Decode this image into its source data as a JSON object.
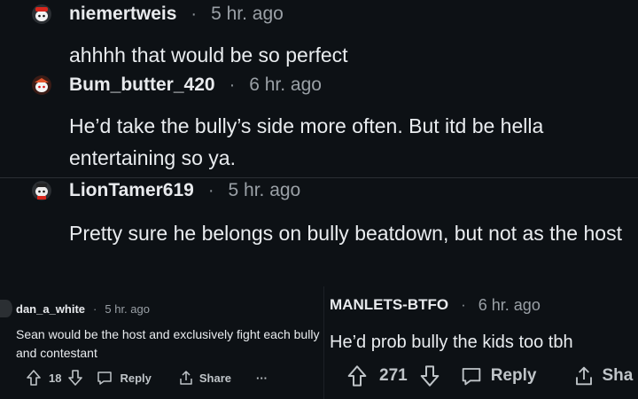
{
  "colors": {
    "background": "#0d1115",
    "text": "#e9ecef",
    "meta": "#9aa0a6",
    "divider": "#2a2f34"
  },
  "comments": [
    {
      "username": "niemertweis",
      "time": "5 hr. ago",
      "text": "ahhhh that would be so perfect",
      "avatar_icon": "snoo-avatar-icon"
    },
    {
      "username": "Bum_butter_420",
      "time": "6 hr. ago",
      "text": "He’d take the bully’s side more often. But itd be hella entertaining so ya.",
      "avatar_icon": "snoo-avatar-icon"
    },
    {
      "username": "LionTamer619",
      "time": "5 hr. ago",
      "text": "Pretty sure he belongs on bully beatdown, but not as the host",
      "avatar_icon": "snoo-avatar-icon"
    },
    {
      "username": "dan_a_white",
      "time": "5 hr. ago",
      "text": "Sean would be the host and exclusively fight each bully and contestant",
      "votes": "18",
      "reply_label": "Reply",
      "share_label": "Share",
      "more_label": "···"
    },
    {
      "username": "MANLETS-BTFO",
      "time": "6 hr. ago",
      "text": "He’d prob bully the kids too tbh",
      "votes": "271",
      "reply_label": "Reply",
      "share_label": "Sha"
    }
  ],
  "separator": "·"
}
